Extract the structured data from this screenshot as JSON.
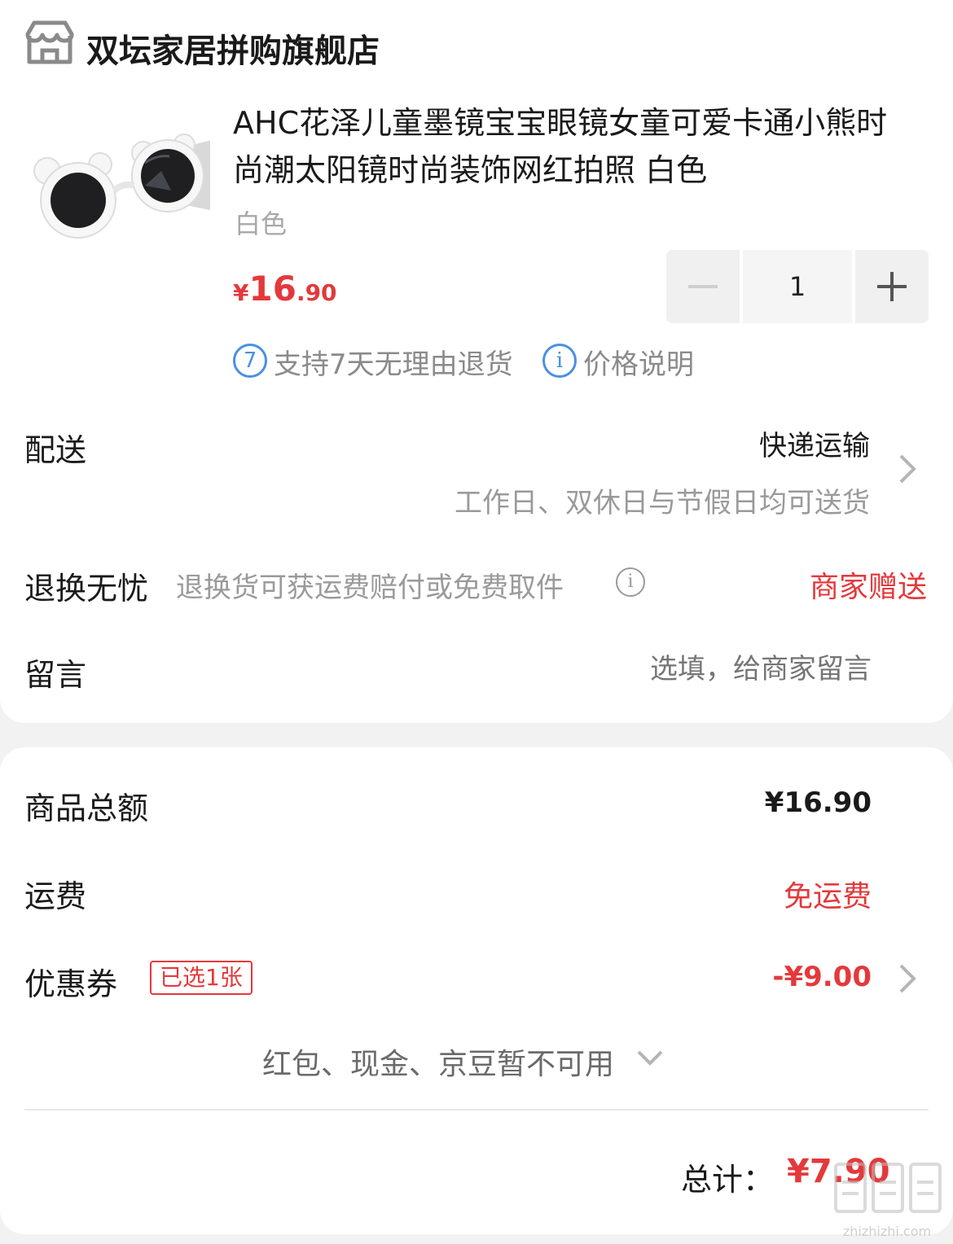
{
  "shop": {
    "name": "双坛家居拼购旗舰店",
    "icon": "store-icon"
  },
  "product": {
    "title": "AHC花泽儿童墨镜宝宝眼镜女童可爱卡通小熊时尚潮太阳镜时尚装饰网红拍照 白色",
    "spec": "白色",
    "price_currency": "¥",
    "price_int": "16",
    "price_dec": ".90",
    "quantity": "1"
  },
  "badges": {
    "return_num": "7",
    "return_text": "支持7天无理由退货",
    "info_glyph": "i",
    "price_text": "价格说明"
  },
  "delivery": {
    "label": "配送",
    "method": "快递运输",
    "note": "工作日、双休日与节假日均可送货"
  },
  "returns": {
    "label": "退换无忧",
    "desc": "退换货可获运费赔付或免费取件",
    "info_glyph": "i",
    "status": "商家赠送"
  },
  "message": {
    "label": "留言",
    "placeholder": "选填，给商家留言"
  },
  "summary": {
    "goods_label": "商品总额",
    "goods_value": "¥16.90",
    "shipping_label": "运费",
    "shipping_value": "免运费",
    "coupon_label": "优惠券",
    "coupon_tag": "已选1张",
    "coupon_value": "-¥9.00",
    "unavailable": "红包、现金、京豆暂不可用",
    "total_label": "总计：",
    "total_value": "¥7.90"
  },
  "watermark": {
    "text": "zhizhizhi.com"
  },
  "colors": {
    "accent": "#e4393c",
    "info_blue": "#4a90e2",
    "muted": "#9a9a9a"
  }
}
